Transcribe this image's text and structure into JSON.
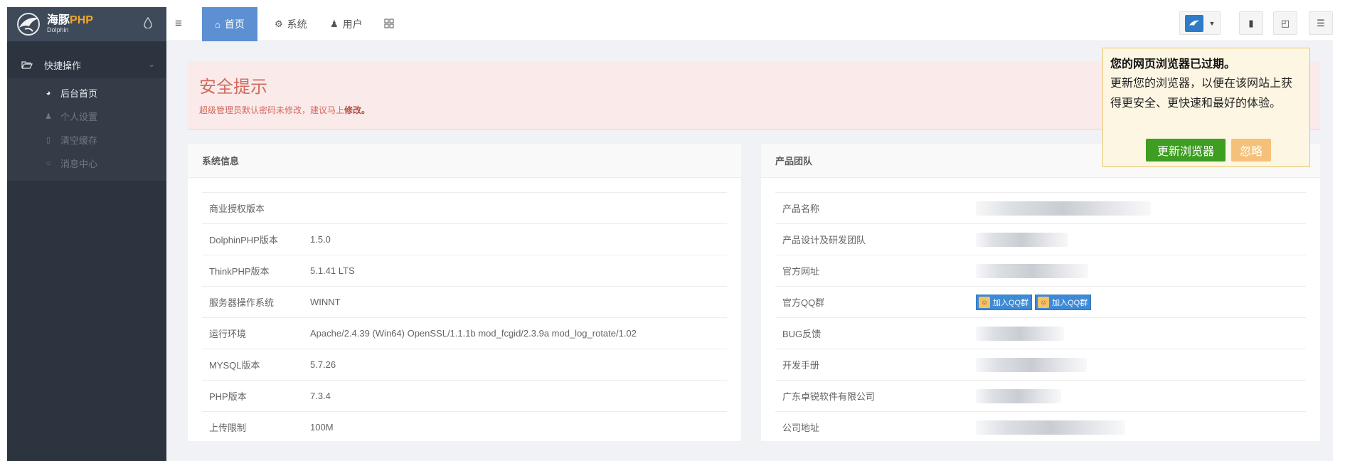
{
  "colors": {
    "accent": "#5c90d2",
    "sidebar_bg": "#2c343f",
    "alert_text": "#d26a5c",
    "popup_bg": "#fdf6e3",
    "update_btn": "#3d9e21",
    "ignore_btn": "#f5c17a"
  },
  "brand": {
    "name_cn": "海豚",
    "name_php": "PHP",
    "sub": "Dolphin",
    "theme_icon": "droplet-icon"
  },
  "sidebar": {
    "group_label": "快捷操作",
    "items": [
      {
        "label": "后台首页",
        "icon": "dashboard-icon",
        "active": true
      },
      {
        "label": "个人设置",
        "icon": "user-icon",
        "active": false
      },
      {
        "label": "清空缓存",
        "icon": "trash-icon",
        "active": false
      },
      {
        "label": "消息中心",
        "icon": "chat-icon",
        "active": false
      }
    ]
  },
  "topbar": {
    "tabs": [
      {
        "label": "首页",
        "icon": "home-icon",
        "active": true
      },
      {
        "label": "系统",
        "icon": "gear-icon",
        "active": false
      },
      {
        "label": "用户",
        "icon": "user-icon",
        "active": false
      },
      {
        "label": "",
        "icon": "grid-icon",
        "active": false
      }
    ],
    "right_buttons": [
      "trash-icon",
      "external-link-icon",
      "sidebar-toggle-icon"
    ]
  },
  "alert": {
    "title": "安全提示",
    "text": "超级管理员默认密码未修改，建议马上",
    "link": "修改。"
  },
  "system_info": {
    "title": "系统信息",
    "rows": [
      {
        "key": "商业授权版本",
        "value": ""
      },
      {
        "key": "DolphinPHP版本",
        "value": "1.5.0"
      },
      {
        "key": "ThinkPHP版本",
        "value": "5.1.41 LTS"
      },
      {
        "key": "服务器操作系统",
        "value": "WINNT"
      },
      {
        "key": "运行环境",
        "value": "Apache/2.4.39 (Win64) OpenSSL/1.1.1b mod_fcgid/2.3.9a mod_log_rotate/1.02"
      },
      {
        "key": "MYSQL版本",
        "value": "5.7.26"
      },
      {
        "key": "PHP版本",
        "value": "7.3.4"
      },
      {
        "key": "上传限制",
        "value": "100M"
      }
    ]
  },
  "product_team": {
    "title": "产品团队",
    "rows": [
      {
        "key": "产品名称"
      },
      {
        "key": "产品设计及研发团队"
      },
      {
        "key": "官方网址"
      },
      {
        "key": "官方QQ群"
      },
      {
        "key": "BUG反馈"
      },
      {
        "key": "开发手册"
      },
      {
        "key": "广东卓锐软件有限公司"
      },
      {
        "key": "公司地址"
      }
    ],
    "qq_button": "加入QQ群"
  },
  "browser_popup": {
    "title": "您的网页浏览器已过期。",
    "body": "更新您的浏览器，以便在该网站上获得更安全、更快速和最好的体验。",
    "update_label": "更新浏览器",
    "ignore_label": "忽略"
  }
}
